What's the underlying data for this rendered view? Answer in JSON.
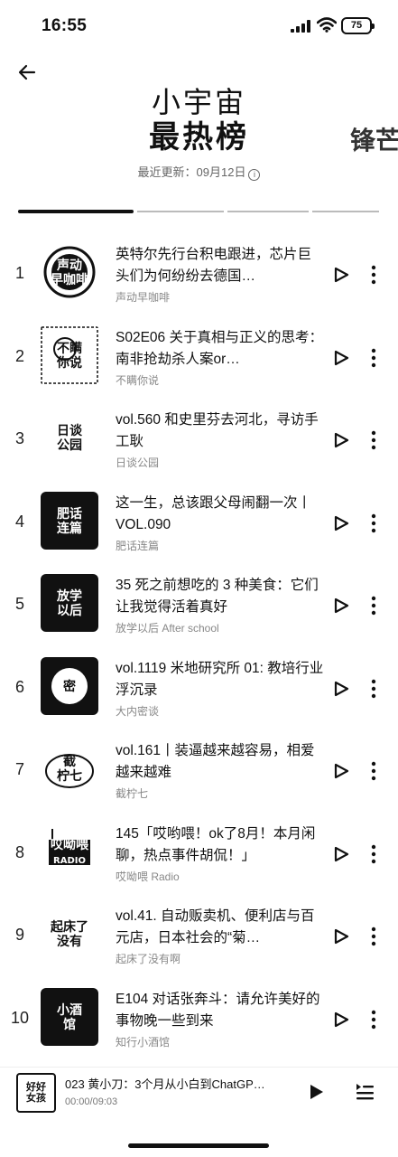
{
  "status_bar": {
    "time": "16:55",
    "battery": "75"
  },
  "header": {
    "title_line1": "小宇宙",
    "title_line2": "最热榜",
    "next_board_peek": "锋芒",
    "update_text": "最近更新：09月12日"
  },
  "episodes": [
    {
      "rank": "1",
      "title": "英特尔先行台积电跟进，芯片巨头们为何纷纷去德国…",
      "show": "声动早咖啡",
      "cover_text": "声动\n早咖啡",
      "cover_style": "circle"
    },
    {
      "rank": "2",
      "title": "S02E06 关于真相与正义的思考：南非抢劫杀人案or…",
      "show": "不瞒你说",
      "cover_text": "不瞒\n你说",
      "cover_style": "sketch"
    },
    {
      "rank": "3",
      "title": "vol.560 和史里芬去河北，寻访手工耿",
      "show": "日谈公园",
      "cover_text": "日谈\n公园",
      "cover_style": "plain"
    },
    {
      "rank": "4",
      "title": "这一生，总该跟父母闹翻一次丨VOL.090",
      "show": "肥话连篇",
      "cover_text": "肥话\n连篇",
      "cover_style": "black"
    },
    {
      "rank": "5",
      "title": "35 死之前想吃的 3 种美食：它们让我觉得活着真好",
      "show": "放学以后 After school",
      "cover_text": "放学\n以后",
      "cover_style": "black"
    },
    {
      "rank": "6",
      "title": "vol.1119 米地研究所 01: 教培行业浮沉录",
      "show": "大内密谈",
      "cover_text": "密",
      "cover_style": "dark-circle"
    },
    {
      "rank": "7",
      "title": "vol.161丨装逼越来越容易，相爱越来越难",
      "show": "截柠七",
      "cover_text": "截\n柠七",
      "cover_style": "lemon"
    },
    {
      "rank": "8",
      "title": "145「哎哟喂！ok了8月！本月闲聊，热点事件胡侃！」",
      "show": "哎呦喂 Radio",
      "cover_text": "哎呦喂\nRADIO",
      "cover_style": "radio"
    },
    {
      "rank": "9",
      "title": "vol.41. 自动贩卖机、便利店与百元店，日本社会的“菊…",
      "show": "起床了没有啊",
      "cover_text": "起床了\n没有",
      "cover_style": "plain"
    },
    {
      "rank": "10",
      "title": "E104 对话张奔斗：请允许美好的事物晚一些到来",
      "show": "知行小酒馆",
      "cover_text": "小酒\n馆",
      "cover_style": "black"
    }
  ],
  "player": {
    "cover_text": "好好\n女孩",
    "title": "023 黄小刀：3个月从小白到ChatGP…",
    "time": "00:00/09:03"
  }
}
